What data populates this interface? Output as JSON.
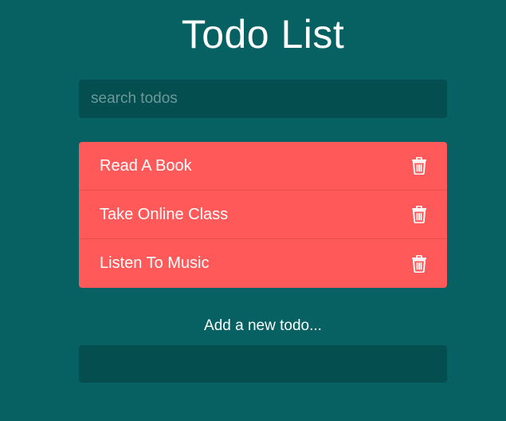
{
  "title": "Todo List",
  "search": {
    "placeholder": "search todos",
    "value": ""
  },
  "todos": [
    {
      "text": "Read A Book",
      "icon": "trash-icon"
    },
    {
      "text": "Take Online Class",
      "icon": "trash-icon"
    },
    {
      "text": "Listen To Music",
      "icon": "trash-icon"
    }
  ],
  "add_form": {
    "label": "Add a new todo...",
    "value": ""
  },
  "colors": {
    "background": "#076163",
    "input_background": "#044e50",
    "todo_background": "#ff5959",
    "text": "#ffffff"
  }
}
